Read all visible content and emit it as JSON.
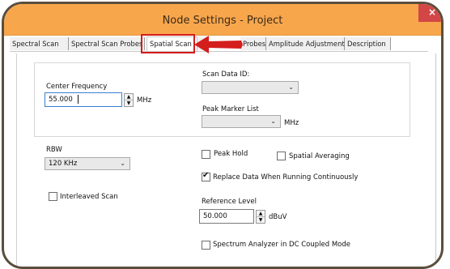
{
  "window": {
    "title": "Node Settings - Project",
    "close_label": "×"
  },
  "tabs": [
    {
      "label": "Spectral Scan"
    },
    {
      "label": "Spectral Scan Probes"
    },
    {
      "label": "Spatial Scan"
    },
    {
      "label": "S"
    },
    {
      "label": "Probes"
    },
    {
      "label": "Amplitude Adjustment"
    },
    {
      "label": "Description"
    }
  ],
  "center_frequency": {
    "label": "Center Frequency",
    "value": "55.000",
    "unit": "MHz"
  },
  "scan_data_id": {
    "label": "Scan Data ID:",
    "value": ""
  },
  "peak_marker_list": {
    "label": "Peak Marker List",
    "value": "",
    "unit": "MHz"
  },
  "rbw": {
    "label": "RBW",
    "value": "120 KHz"
  },
  "peak_hold": {
    "label": "Peak Hold",
    "checked": false
  },
  "spatial_averaging": {
    "label": "Spatial Averaging",
    "checked": false
  },
  "replace_data": {
    "label": "Replace Data When Running Continuously",
    "checked": true
  },
  "interleaved_scan": {
    "label": "Interleaved Scan",
    "checked": false
  },
  "reference_level": {
    "label": "Reference Level",
    "value": "50.000",
    "unit": "dBuV"
  },
  "dc_coupled": {
    "label": "Spectrum Analyzer in DC Coupled Mode",
    "checked": false
  },
  "colors": {
    "titlebar": "#f7a64c",
    "frame": "#5a4e3c",
    "highlight": "#d41d1d",
    "close": "#d24646"
  },
  "icons": {
    "close": "close-icon",
    "arrow": "red-arrow-left-icon",
    "spin_up": "spin-up-icon",
    "spin_down": "spin-down-icon",
    "dropdown": "chevron-down-icon"
  }
}
